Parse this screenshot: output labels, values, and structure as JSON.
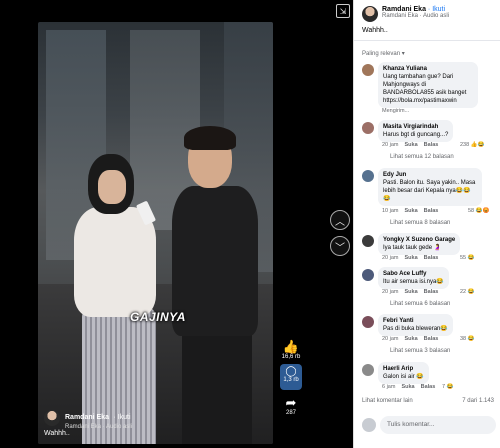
{
  "video": {
    "overlay_text": "GAJINYA",
    "author": "Ramdani Eka",
    "follow": "· Ikuti",
    "audio": "Ramdani Eka · Audio asli",
    "caption": "Wahhh.."
  },
  "actions": {
    "likes": "16,6 rb",
    "comments": "1,3 rb",
    "shares": "287"
  },
  "panel": {
    "author": "Ramdani Eka",
    "follow": "· Ikuti",
    "audio": "Ramdani Eka · Audio asli",
    "caption": "Wahhh..",
    "sort_label": "Paling relevan ▾",
    "more_comments": "Lihat komentar lain",
    "count": "7 dari 1.143",
    "compose_placeholder": "Tulis komentar..."
  },
  "comments": [
    {
      "name": "Khanza Yuliana",
      "text": "Uang tambahan gue? Dari Mahjongways di BANDARBOLA855 asik banget https://bola.mx/pastimaxwin",
      "meta": "Mengirim...",
      "avatar_color": "#a0765a"
    },
    {
      "name": "Masita Virgiarindah",
      "text": "Harus bgt di guncang...?",
      "time": "20 jam",
      "like": "Suka",
      "reply": "Balas",
      "reactions": "238",
      "more": "Lihat semua 12 balasan",
      "avatar_color": "#9c6f66"
    },
    {
      "name": "Edy Jun",
      "text": "Pasti. Balon itu. Saya yakin.. Masa lebih besar dari Kepala nya😂😂😂",
      "time": "10 jam",
      "like": "Suka",
      "reply": "Balas",
      "reactions": "58",
      "more": "Lihat semua 8 balasan",
      "avatar_color": "#56718f"
    },
    {
      "name": "Yongky X Suzeno Garage",
      "text": "Iya tauk tauk gede 🤰",
      "time": "20 jam",
      "like": "Suka",
      "reply": "Balas",
      "reactions": "55",
      "avatar_color": "#3b3b3b"
    },
    {
      "name": "Sabo Ace Luffy",
      "text": "Itu air semua isi.nya😂",
      "time": "20 jam",
      "like": "Suka",
      "reply": "Balas",
      "reactions": "22",
      "more": "Lihat semua 6 balasan",
      "avatar_color": "#4d5a7a"
    },
    {
      "name": "Febri Yanti",
      "text": "Pas di buka bleweran😂",
      "time": "20 jam",
      "like": "Suka",
      "reply": "Balas",
      "reactions": "38",
      "more": "Lihat semua 3 balasan",
      "avatar_color": "#7a4e5a"
    },
    {
      "name": "Haerli Arip",
      "text": "Galon isi air 😂",
      "time": "6 jam",
      "like": "Suka",
      "reply": "Balas",
      "reactions": "7",
      "avatar_color": "#8a8a8a"
    }
  ]
}
